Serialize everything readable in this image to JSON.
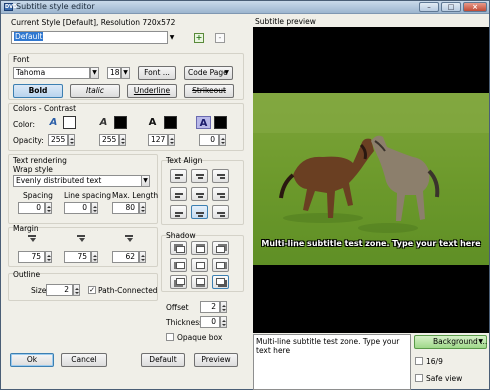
{
  "window": {
    "title": "Subtitle style editor",
    "app_icon": "DVD"
  },
  "header": {
    "current_style": "Current Style [Default], Resolution 720x572",
    "style_name": "Default"
  },
  "font": {
    "section": "Font",
    "family": "Tahoma",
    "size": "18",
    "font_button": "Font ...",
    "code_page": "Code Page",
    "bold": "Bold",
    "italic": "Italic",
    "underline": "Underline",
    "strikeout": "Strikeout"
  },
  "colors": {
    "section": "Colors - Contrast",
    "color_label": "Color:",
    "opacity_label": "Opacity:",
    "opacities": [
      "255",
      "255",
      "127",
      "0"
    ],
    "swatches": [
      "#ffffff",
      "#000000",
      "#000000",
      "#000000"
    ]
  },
  "rendering": {
    "section": "Text rendering",
    "wrap_label": "Wrap style",
    "wrap_value": "Evenly distributed text",
    "spacing_label": "Spacing",
    "line_spacing_label": "Line spacing",
    "max_length_label": "Max. Length",
    "spacing": "0",
    "line_spacing": "0",
    "max_length": "80"
  },
  "margin": {
    "section": "Margin",
    "left": "75",
    "right": "75",
    "vertical": "62"
  },
  "outline": {
    "section": "Outline",
    "size_label": "Size",
    "size": "2",
    "path_connected": "Path-Connected"
  },
  "align": {
    "section": "Text Align"
  },
  "shadow": {
    "section": "Shadow",
    "offset_label": "Offset",
    "offset": "2",
    "thickness_label": "Thickness",
    "thickness": "0",
    "opaque_box": "Opaque box"
  },
  "buttons": {
    "ok": "Ok",
    "cancel": "Cancel",
    "default": "Default",
    "preview": "Preview"
  },
  "preview": {
    "title": "Subtitle preview",
    "subtitle_text": "Multi-line subtitle test zone. Type your text here",
    "test_text": "Multi-line subtitle test zone. Type your text here",
    "background": "Background ...",
    "ratio": "16/9",
    "safe_view": "Safe view"
  }
}
